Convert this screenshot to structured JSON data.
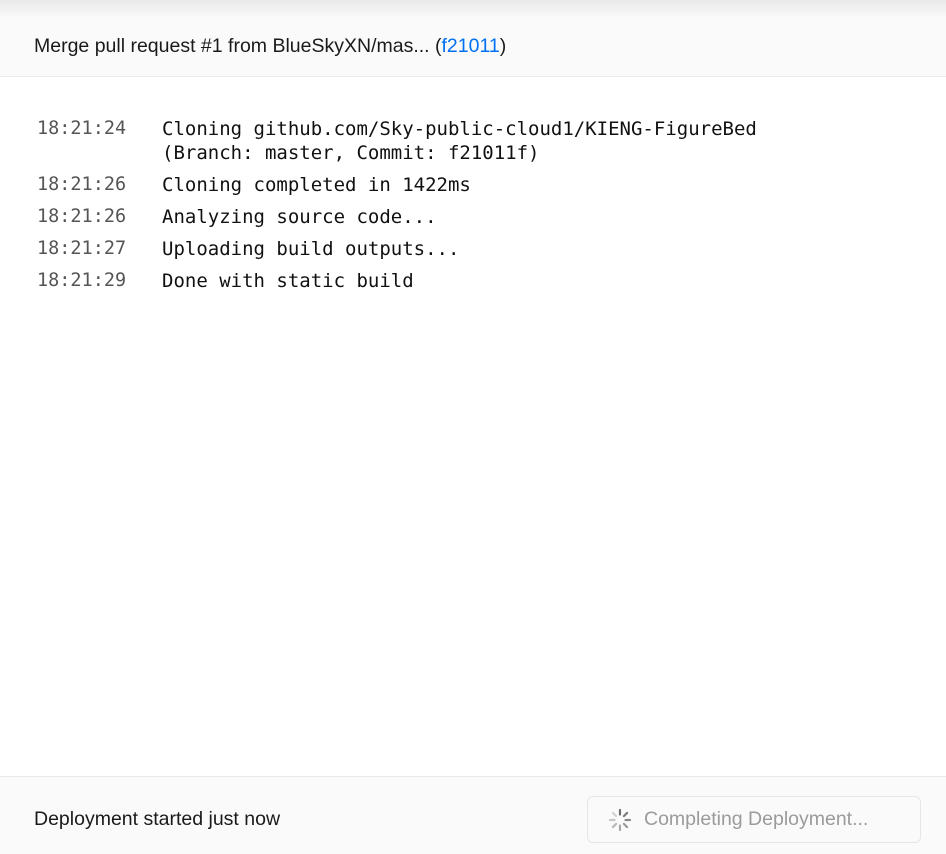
{
  "header": {
    "commit_message": "Merge pull request #1 from BlueSkyXN/mas... (",
    "commit_hash": "f21011",
    "close_paren": ")"
  },
  "log": [
    {
      "time": "18:21:24",
      "message": "Cloning github.com/Sky-public-cloud1/KIENG-FigureBed\n(Branch: master, Commit: f21011f)"
    },
    {
      "time": "18:21:26",
      "message": "Cloning completed in 1422ms"
    },
    {
      "time": "18:21:26",
      "message": "Analyzing source code..."
    },
    {
      "time": "18:21:27",
      "message": "Uploading build outputs..."
    },
    {
      "time": "18:21:29",
      "message": "Done with static build"
    }
  ],
  "footer": {
    "status": "Deployment started just now",
    "button_label": "Completing Deployment...",
    "button_icon": "spinner-icon"
  },
  "colors": {
    "link": "#0070f3",
    "muted_text": "#9b9b9b",
    "panel_bg": "#fafafa"
  }
}
